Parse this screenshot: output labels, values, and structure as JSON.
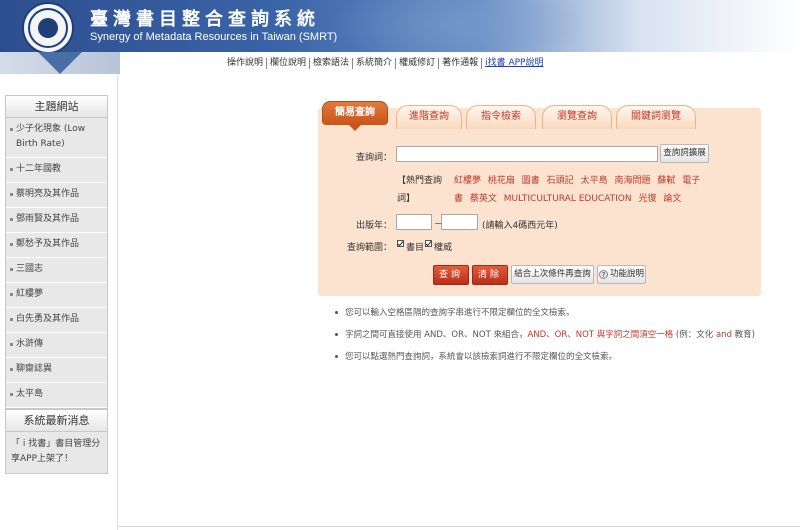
{
  "header": {
    "title": "臺灣書目整合查詢系統",
    "subtitle": "Synergy of Metadata Resources in Taiwan (SMRT)"
  },
  "topnav": [
    {
      "label": "操作說明",
      "link": false
    },
    {
      "label": "欄位說明",
      "link": false
    },
    {
      "label": "檢索語法",
      "link": false
    },
    {
      "label": "系統簡介",
      "link": false
    },
    {
      "label": "權威修訂",
      "link": false
    },
    {
      "label": "著作通報",
      "link": false
    },
    {
      "label": "i找書 APP說明",
      "link": true
    }
  ],
  "sidebar": {
    "topics_title": "主題網站",
    "topics": [
      "少子化現象 (Low Birth Rate)",
      "十二年國教",
      "蔡明亮及其作品",
      "鄧雨賢及其作品",
      "鄭愁予及其作品",
      "三國志",
      "紅樓夢",
      "白先勇及其作品",
      "水滸傳",
      "聊齋誌異",
      "太平島"
    ],
    "news_title": "系統最新消息",
    "news_text": "「 i 找書」書目管理分享APP上架了！"
  },
  "tabs": [
    {
      "label": "簡易查詢",
      "active": true
    },
    {
      "label": "進階查詢",
      "active": false
    },
    {
      "label": "指令檢索",
      "active": false
    },
    {
      "label": "瀏覽查詢",
      "active": false
    },
    {
      "label": "關鍵詞瀏覽",
      "active": false
    }
  ],
  "search": {
    "query_label": "查詢詞：",
    "query_value": "",
    "expand_button": "查詢詞擴展",
    "hot_label": "【熱門查詢詞】",
    "hot_terms": [
      "紅樓夢",
      "桃花扇",
      "圖書",
      "石頭記",
      "太平島",
      "南海問題",
      "蘇軾",
      "電子書",
      "蔡英文",
      "MULTICULTURAL EDUCATION",
      "光復",
      "論文"
    ],
    "year_label": "出版年：",
    "year_separator": "－",
    "year_from": "",
    "year_to": "",
    "year_hint": "(請輸入4碼西元年)",
    "scope_label": "查詢範圍：",
    "scope_options": [
      {
        "label": "書目",
        "checked": true
      },
      {
        "label": "權威",
        "checked": true
      }
    ],
    "submit_button": "查詢",
    "clear_button": "清除",
    "combine_button": "結合上次條件再查詢",
    "help_icon": "?",
    "help_button": "功能說明"
  },
  "tips": {
    "tip1": "您可以輸入空格區隔的查詢字串進行不限定欄位的全文檢索。",
    "tip2_a": "字詞之間可直接使用 AND、OR、NOT 來組合，",
    "tip2_b": "AND、OR、NOT 與字詞之間須空一格",
    "tip2_c": " (例：文化 ",
    "tip2_d": "and",
    "tip2_e": " 教育)",
    "tip3": "您可以點選熱門查詢詞，系統會以該檢索詞進行不限定欄位的全文檢索。"
  },
  "colors": {
    "accent": "#c0392b",
    "panel": "#fbe3cf",
    "header": "#2d4e8e"
  }
}
